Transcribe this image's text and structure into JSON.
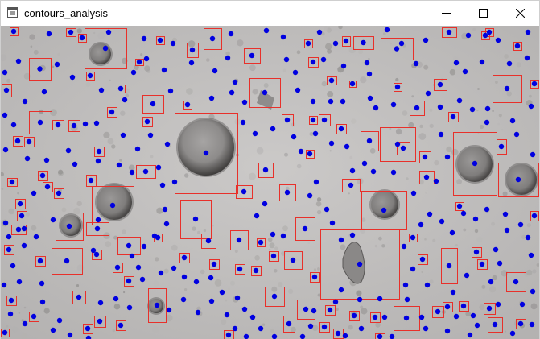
{
  "window": {
    "title": "contours_analysis",
    "controls": [
      "minimize-icon",
      "maximize-icon",
      "close-icon"
    ]
  },
  "image": {
    "content": "microscope image with detected contours",
    "bounding_box_color": "#e8302a",
    "centroid_color": "#0000e0",
    "background_color": "#bdbbba"
  }
}
